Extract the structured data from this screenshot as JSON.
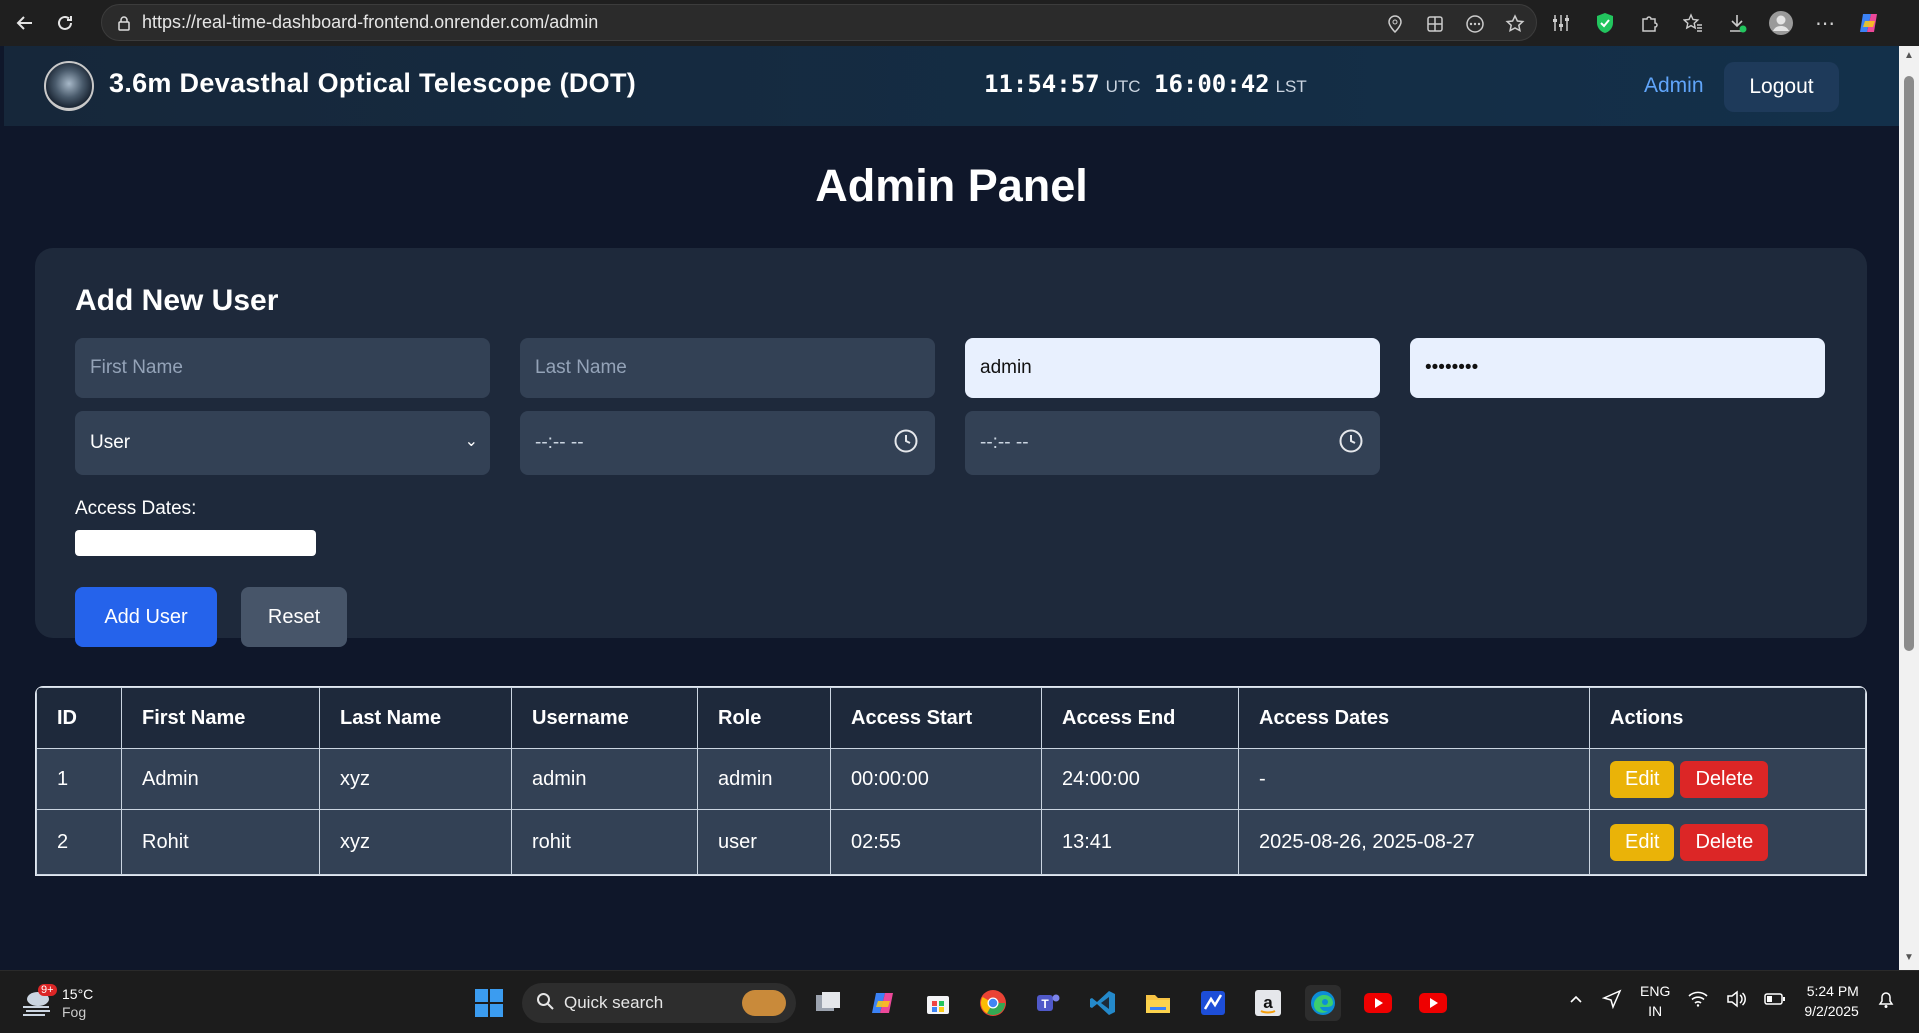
{
  "browser": {
    "url": "https://real-time-dashboard-frontend.onrender.com/admin"
  },
  "header": {
    "title": "3.6m Devasthal Optical Telescope (DOT)",
    "utc_time": "11:54:57",
    "utc_label": "UTC",
    "lst_time": "16:00:42",
    "lst_label": "LST",
    "admin_link": "Admin",
    "logout": "Logout"
  },
  "page_title": "Admin Panel",
  "form": {
    "title": "Add New User",
    "first_name_placeholder": "First Name",
    "last_name_placeholder": "Last Name",
    "username_value": "admin",
    "password_value": "••••••••",
    "role_value": "User",
    "access_start_value": "--:-- --",
    "access_end_value": "--:-- --",
    "access_dates_label": "Access Dates:",
    "add_button": "Add User",
    "reset_button": "Reset"
  },
  "table": {
    "headers": [
      "ID",
      "First Name",
      "Last Name",
      "Username",
      "Role",
      "Access Start",
      "Access End",
      "Access Dates",
      "Actions"
    ],
    "rows": [
      {
        "id": "1",
        "first": "Admin",
        "last": "xyz",
        "username": "admin",
        "role": "admin",
        "start": "00:00:00",
        "end": "24:00:00",
        "dates": "-"
      },
      {
        "id": "2",
        "first": "Rohit",
        "last": "xyz",
        "username": "rohit",
        "role": "user",
        "start": "02:55",
        "end": "13:41",
        "dates": "2025-08-26, 2025-08-27"
      }
    ],
    "edit_label": "Edit",
    "delete_label": "Delete"
  },
  "taskbar": {
    "weather_temp": "15°C",
    "weather_desc": "Fog",
    "weather_badge": "9+",
    "search_label": "Quick search",
    "lang_1": "ENG",
    "lang_2": "IN",
    "time": "5:24 PM",
    "date": "9/2/2025"
  },
  "colors": {
    "page_bg": "#0f172a",
    "card_bg": "#1e293b",
    "input_bg": "#334155",
    "primary": "#2563eb",
    "edit": "#eab308",
    "delete": "#dc2626",
    "link": "#60a5fa"
  }
}
